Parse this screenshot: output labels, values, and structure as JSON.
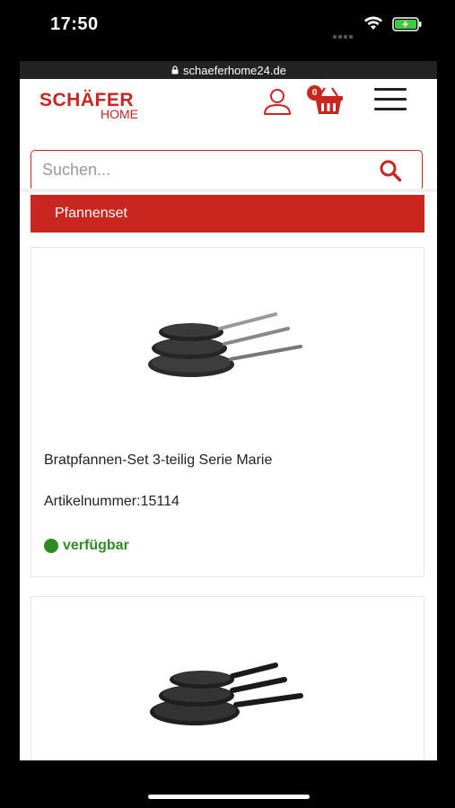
{
  "status_bar": {
    "time": "17:50"
  },
  "browser": {
    "url": "schaeferhome24.de"
  },
  "header": {
    "logo_top": "SCHÄFER",
    "logo_bottom": "HOME",
    "cart_count": "0"
  },
  "search": {
    "placeholder": "Suchen..."
  },
  "category": {
    "label": "Pfannenset"
  },
  "products": [
    {
      "name": "Bratpfannen-Set 3-teilig Serie Marie",
      "sku": "Artikelnummer:15114",
      "stock": "verfügbar"
    }
  ],
  "colors": {
    "brand": "#c8261e",
    "in_stock": "#2e8b22"
  }
}
